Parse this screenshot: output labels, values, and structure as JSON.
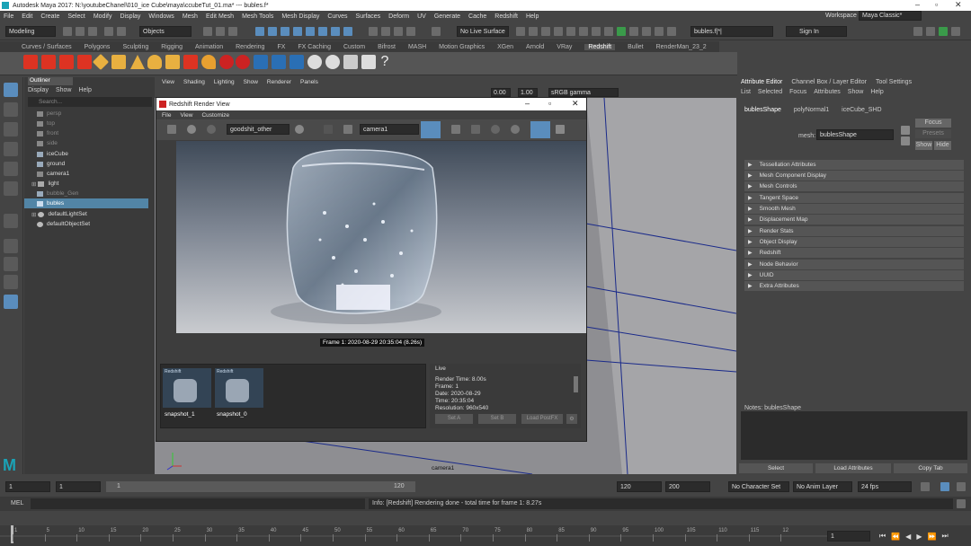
{
  "window": {
    "title": "Autodesk Maya 2017: N:\\youtubeChanel\\010_ice Cube\\maya\\ccubeTut_01.ma*  ---  bubles.f*"
  },
  "menu": [
    "File",
    "Edit",
    "Create",
    "Select",
    "Modify",
    "Display",
    "Windows",
    "Mesh",
    "Edit Mesh",
    "Mesh Tools",
    "Mesh Display",
    "Curves",
    "Surfaces",
    "Deform",
    "UV",
    "Generate",
    "Cache",
    "Redshift",
    "Help"
  ],
  "workspace": {
    "label": "Workspace :",
    "value": "Maya Classic*"
  },
  "statusline": {
    "mode": "Modeling",
    "objects": "Objects",
    "live": "No Live Surface",
    "search": "bubles.f|*|",
    "sign_in": "Sign In"
  },
  "shelf_tabs": [
    "Curves / Surfaces",
    "Polygons",
    "Sculpting",
    "Rigging",
    "Animation",
    "Rendering",
    "FX",
    "FX Caching",
    "Custom",
    "Bifrost",
    "MASH",
    "Motion Graphics",
    "XGen",
    "Arnold",
    "VRay",
    "Redshift",
    "Bullet",
    "RenderMan_23_2"
  ],
  "shelf_active": "Redshift",
  "outliner": {
    "title": "Outliner",
    "menu": [
      "Display",
      "Show",
      "Help"
    ],
    "search_placeholder": "Search...",
    "items": [
      {
        "label": "persp"
      },
      {
        "label": "top"
      },
      {
        "label": "front"
      },
      {
        "label": "side"
      },
      {
        "label": "iceCube"
      },
      {
        "label": "ground"
      },
      {
        "label": "camera1"
      },
      {
        "label": "light"
      },
      {
        "label": "bubble_Gen"
      },
      {
        "label": "bubles"
      },
      {
        "label": "defaultLightSet"
      },
      {
        "label": "defaultObjectSet"
      }
    ]
  },
  "viewport": {
    "menu": [
      "View",
      "Shading",
      "Lighting",
      "Show",
      "Renderer",
      "Panels"
    ],
    "field1": "0.00",
    "field2": "1.00",
    "colorspace": "sRGB gamma",
    "camera_label": "camera1"
  },
  "render_view": {
    "title": "Redshift Render View",
    "menu": [
      "File",
      "View",
      "Customize"
    ],
    "preset": "goodshit_other",
    "camera": "camera1",
    "frame_caption": "Frame 1:  2020-08-29  20:35:04  (8.26s)",
    "snapshots": [
      {
        "label": "snapshot_1",
        "header": "Redshift"
      },
      {
        "label": "snapshot_0",
        "header": "Redshift"
      }
    ],
    "info": {
      "title": "Live",
      "lines": [
        "Render Time: 8.00s",
        "Frame: 1",
        "Date: 2020-08-29",
        "Time: 20:35:04",
        "Resolution: 960x540"
      ]
    },
    "buttons": {
      "set_a": "Set A",
      "set_b": "Set B",
      "load_postfx": "Load PostFX"
    }
  },
  "attribute_editor": {
    "tabs": [
      "Attribute Editor",
      "Channel Box / Layer Editor",
      "Tool Settings"
    ],
    "menu": [
      "List",
      "Selected",
      "Focus",
      "Attributes",
      "Show",
      "Help"
    ],
    "node_tabs": [
      "bublesShape",
      "polyNormal1",
      "iceCube_SHD"
    ],
    "mesh_label": "mesh:",
    "mesh_value": "bublesShape",
    "focus": "Focus",
    "presets": "Presets",
    "show": "Show",
    "hide": "Hide",
    "sections": [
      "Tessellation Attributes",
      "Mesh Component Display",
      "Mesh Controls",
      "Tangent Space",
      "Smooth Mesh",
      "Displacement Map",
      "Render Stats",
      "Object Display",
      "Redshift",
      "Node Behavior",
      "UUID",
      "Extra Attributes"
    ],
    "notes": "Notes:  bublesShape",
    "bottom": {
      "select": "Select",
      "load": "Load Attributes",
      "copy": "Copy Tab"
    }
  },
  "timeline": {
    "start": "1",
    "start2": "1",
    "range_start": "1",
    "range_mid": "120",
    "end1": "120",
    "end2": "200",
    "character": "No Character Set",
    "anim_layer": "No Anim Layer",
    "fps": "24 fps",
    "current": "1",
    "ticks": [
      "1",
      "5",
      "10",
      "15",
      "20",
      "25",
      "30",
      "35",
      "40",
      "45",
      "50",
      "55",
      "60",
      "65",
      "70",
      "75",
      "80",
      "85",
      "90",
      "95",
      "100",
      "105",
      "110",
      "115",
      "12"
    ]
  },
  "command": {
    "label": "MEL",
    "message": "Info: [Redshift] Rendering done - total time for frame 1: 8.27s"
  }
}
